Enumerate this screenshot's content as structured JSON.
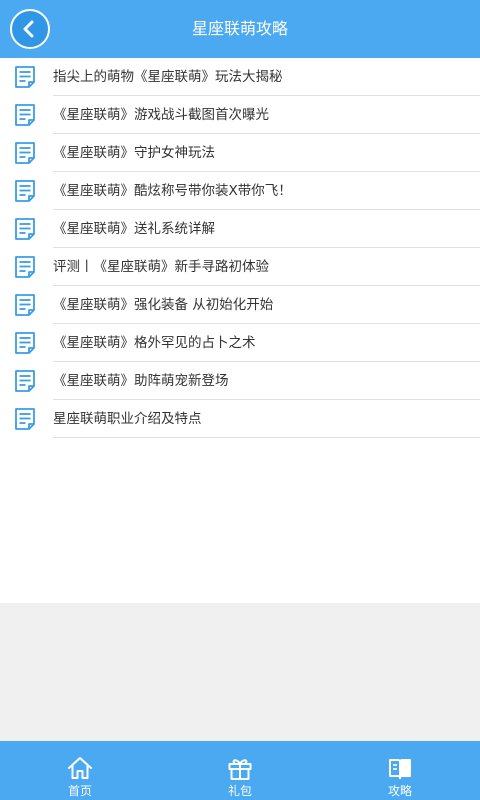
{
  "header": {
    "title": "星座联萌攻略",
    "back_icon": "chevron-left-icon"
  },
  "articles": [
    {
      "title": "指尖上的萌物《星座联萌》玩法大揭秘",
      "icon": "document-icon"
    },
    {
      "title": "《星座联萌》游戏战斗截图首次曝光",
      "icon": "document-icon"
    },
    {
      "title": "《星座联萌》守护女神玩法",
      "icon": "document-icon"
    },
    {
      "title": "《星座联萌》酷炫称号带你装X带你飞！",
      "icon": "document-icon"
    },
    {
      "title": "《星座联萌》送礼系统详解",
      "icon": "document-icon"
    },
    {
      "title": "评测丨《星座联萌》新手寻路初体验",
      "icon": "document-icon"
    },
    {
      "title": "《星座联萌》强化装备 从初始化开始",
      "icon": "document-icon"
    },
    {
      "title": "《星座联萌》格外罕见的占卜之术",
      "icon": "document-icon"
    },
    {
      "title": "《星座联萌》助阵萌宠新登场",
      "icon": "document-icon"
    },
    {
      "title": "星座联萌职业介绍及特点",
      "icon": "document-icon"
    }
  ],
  "tabbar": {
    "tabs": [
      {
        "label": "首页",
        "icon": "home-icon"
      },
      {
        "label": "礼包",
        "icon": "gift-icon"
      },
      {
        "label": "攻略",
        "icon": "book-icon",
        "active": true
      }
    ]
  },
  "colors": {
    "accent": "#4aa9f0",
    "icon_blue": "#3a9de6",
    "text": "#333333",
    "divider": "#e2e2e2",
    "background": "#f0f0f0"
  }
}
